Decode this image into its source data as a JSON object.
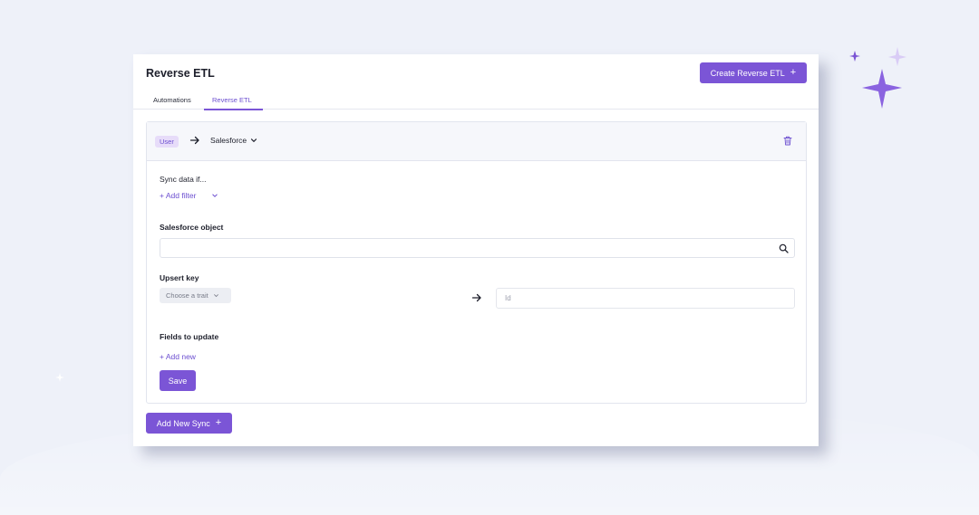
{
  "window": {
    "title": "Reverse ETL",
    "create_button_label": "Create Reverse ETL",
    "create_button_icon": "+"
  },
  "tabs": [
    {
      "label": "Automations",
      "active": false
    },
    {
      "label": "Reverse ETL",
      "active": true
    }
  ],
  "sync_card": {
    "source_badge": "User",
    "arrow_icon": "arrow-right-icon",
    "destination": "Salesforce",
    "delete_icon": "trash-icon",
    "sync_if_label": "Sync data if...",
    "add_filter_label": "+ Add filter",
    "salesforce_object_label": "Salesforce object",
    "salesforce_object_value": "",
    "search_icon": "search-icon",
    "upsert_key_label": "Upsert key",
    "trait_select_value": "Choose a trait",
    "id_field_placeholder": "Id",
    "fields_to_update_label": "Fields to update",
    "add_new_label": "+ Add new",
    "save_label": "Save"
  },
  "footer": {
    "add_new_sync_label": "Add New Sync",
    "add_new_sync_icon": "+"
  },
  "colors": {
    "accent": "#7b55d6",
    "background": "#eef1f9",
    "badge_bg": "#e7dcf9"
  }
}
